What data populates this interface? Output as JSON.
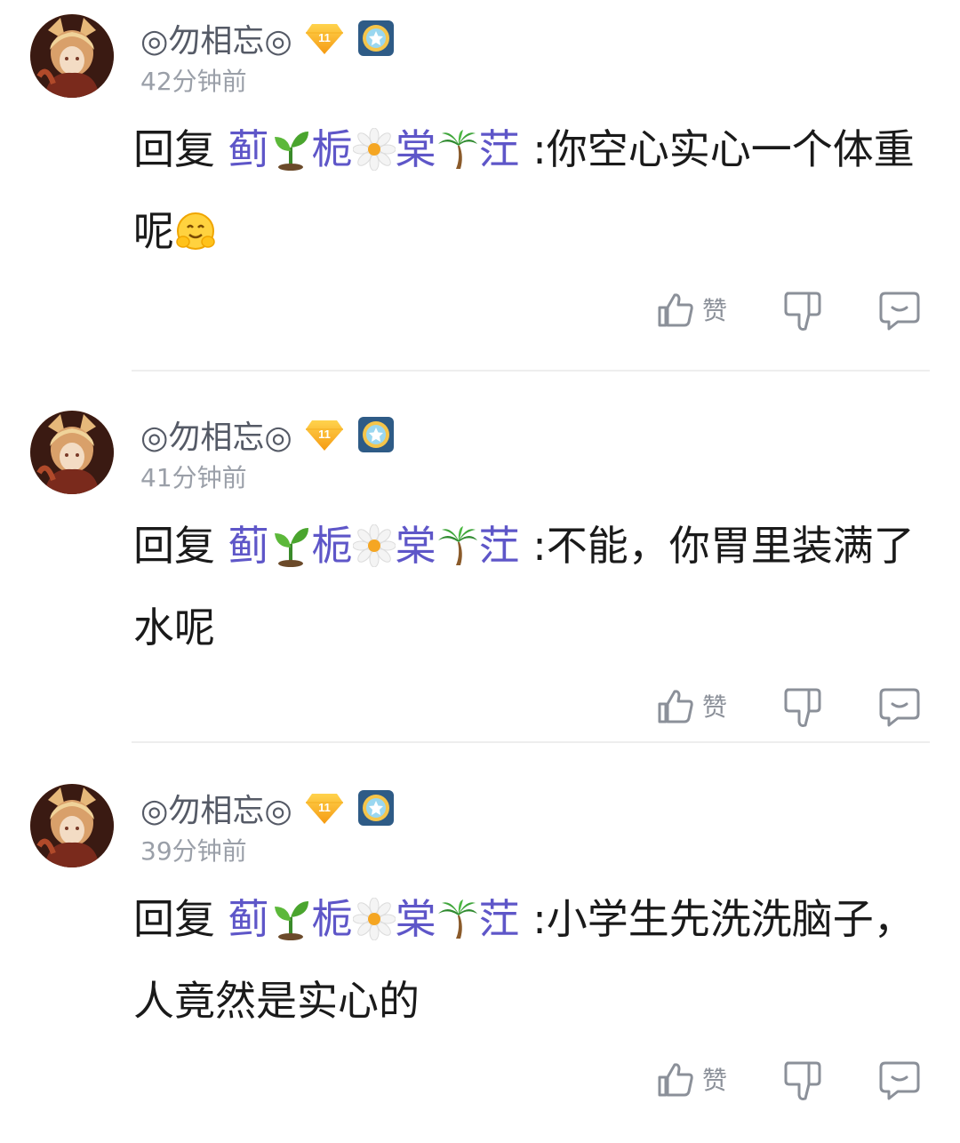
{
  "comments": [
    {
      "username": "◎勿相忘◎",
      "level": "11",
      "time": "42分钟前",
      "reply_prefix": "回复",
      "mention_chars": [
        "蓟",
        "栀",
        "棠",
        "茳"
      ],
      "separator": " :",
      "text": "你空心实心一个体重呢",
      "trailing_emoji": "hug-emoji",
      "like_label": "赞"
    },
    {
      "username": "◎勿相忘◎",
      "level": "11",
      "time": "41分钟前",
      "reply_prefix": "回复",
      "mention_chars": [
        "蓟",
        "栀",
        "棠",
        "茳"
      ],
      "separator": " :",
      "text": "不能，你胃里装满了水呢",
      "like_label": "赞"
    },
    {
      "username": "◎勿相忘◎",
      "level": "11",
      "time": "39分钟前",
      "reply_prefix": "回复",
      "mention_chars": [
        "蓟",
        "栀",
        "棠",
        "茳"
      ],
      "separator": " :",
      "text": "小学生先洗洗脑子，人竟然是实心的",
      "like_label": "赞"
    }
  ],
  "colors": {
    "mention": "#5e56c8",
    "username": "#555a66",
    "time": "#9a9fa8",
    "icon": "#8b9099"
  },
  "icons": [
    "avatar-image",
    "diamond-level-badge",
    "medal-badge",
    "seedling-emoji",
    "blossom-emoji",
    "palm-tree-emoji",
    "hug-emoji",
    "thumbs-up-icon",
    "thumbs-down-icon",
    "comment-icon"
  ]
}
